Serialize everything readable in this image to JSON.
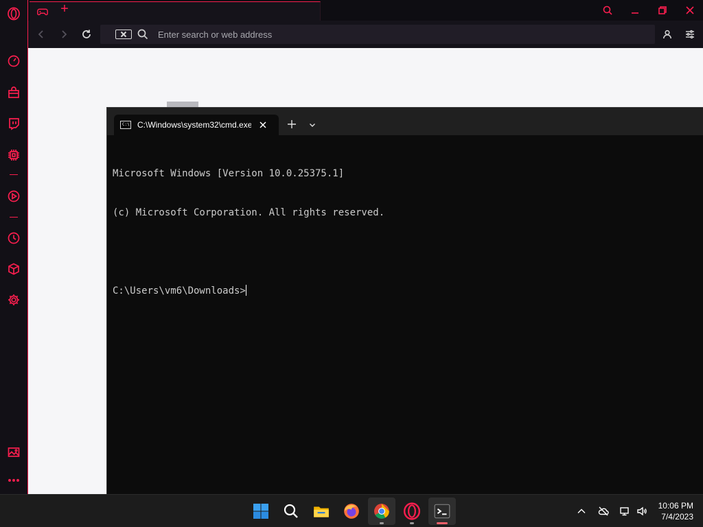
{
  "browser": {
    "address_placeholder": "Enter search or web address"
  },
  "terminal": {
    "tab_title": "C:\\Windows\\system32\\cmd.exe",
    "lines": [
      "Microsoft Windows [Version 10.0.25375.1]",
      "(c) Microsoft Corporation. All rights reserved.",
      "",
      "C:\\Users\\vm6\\Downloads>"
    ]
  },
  "taskbar": {
    "time": "10:06 PM",
    "date": "7/4/2023"
  },
  "colors": {
    "accent": "#fa1e4e",
    "terminal_bg": "#0c0c0c",
    "taskbar_bg": "#1c1c1c"
  },
  "icons": {
    "sidebar": [
      "opera-logo-icon",
      "speed-dial-icon",
      "shopping-bag-icon",
      "twitch-icon",
      "gx-control-icon",
      "player-icon",
      "history-icon",
      "extensions-icon",
      "settings-icon",
      "gallery-icon",
      "more-icon"
    ],
    "taskbar": [
      "windows-start-icon",
      "search-icon",
      "file-explorer-icon",
      "firefox-icon",
      "chrome-icon",
      "opera-gx-icon",
      "terminal-icon"
    ],
    "tray": [
      "chevron-up-icon",
      "onedrive-icon",
      "network-icon",
      "volume-icon"
    ]
  }
}
